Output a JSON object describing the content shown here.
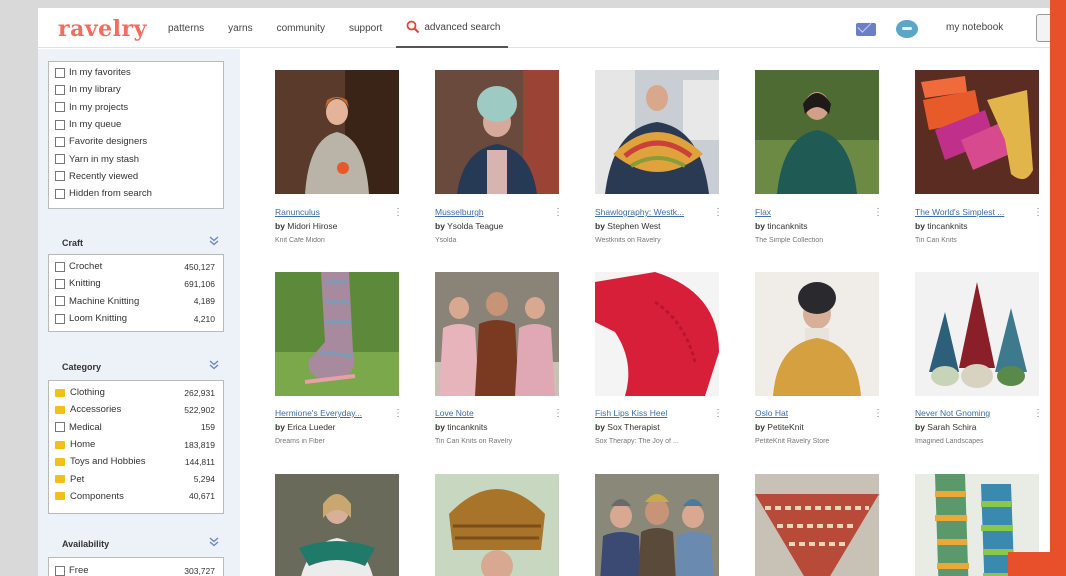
{
  "header": {
    "logo": "ravelry",
    "nav": [
      "patterns",
      "yarns",
      "community",
      "support"
    ],
    "advanced_search": "advanced search",
    "notebook": "my notebook"
  },
  "sidebar": {
    "personal_filters": [
      "In my favorites",
      "In my library",
      "In my projects",
      "In my queue",
      "Favorite designers",
      "Yarn in my stash",
      "Recently viewed",
      "Hidden from search"
    ],
    "craft": {
      "title": "Craft",
      "items": [
        {
          "label": "Crochet",
          "count": "450,127"
        },
        {
          "label": "Knitting",
          "count": "691,106"
        },
        {
          "label": "Machine Knitting",
          "count": "4,189"
        },
        {
          "label": "Loom Knitting",
          "count": "4,210"
        }
      ]
    },
    "category": {
      "title": "Category",
      "items": [
        {
          "label": "Clothing",
          "count": "262,931",
          "icon": "folder"
        },
        {
          "label": "Accessories",
          "count": "522,902",
          "icon": "folder"
        },
        {
          "label": "Medical",
          "count": "159",
          "icon": "checkbox"
        },
        {
          "label": "Home",
          "count": "183,819",
          "icon": "folder"
        },
        {
          "label": "Toys and Hobbies",
          "count": "144,811",
          "icon": "folder"
        },
        {
          "label": "Pet",
          "count": "5,294",
          "icon": "folder"
        },
        {
          "label": "Components",
          "count": "40,671",
          "icon": "folder"
        }
      ]
    },
    "availability": {
      "title": "Availability",
      "items": [
        {
          "label": "Free",
          "count": "303,727"
        }
      ]
    }
  },
  "patterns": [
    {
      "title": "Ranunculus",
      "by": "by",
      "designer": "Midori Hirose",
      "source": "Knit Cafe Midori"
    },
    {
      "title": "Musselburgh",
      "by": "by",
      "designer": "Ysolda Teague",
      "source": "Ysolda"
    },
    {
      "title": "Shawlography: Westk...",
      "by": "by",
      "designer": "Stephen West",
      "source": "Westknits on Ravelry"
    },
    {
      "title": "Flax",
      "by": "by",
      "designer": "tincanknits",
      "source": "The Simple Collection"
    },
    {
      "title": "The World's Simplest ...",
      "by": "by",
      "designer": "tincanknits",
      "source": "Tin Can Knits"
    },
    {
      "title": "Hermione's Everyday...",
      "by": "by",
      "designer": "Erica Lueder",
      "source": "Dreams in Fiber"
    },
    {
      "title": "Love Note",
      "by": "by",
      "designer": "tincanknits",
      "source": "Tin Can Knits on Ravelry"
    },
    {
      "title": "Fish Lips Kiss Heel",
      "by": "by",
      "designer": "Sox Therapist",
      "source": "Sox Therapy: The Joy of ..."
    },
    {
      "title": "Oslo Hat",
      "by": "by",
      "designer": "PetiteKnit",
      "source": "PetiteKnit Ravelry Store"
    },
    {
      "title": "Never Not Gnoming",
      "by": "by",
      "designer": "Sarah Schira",
      "source": "Imagined Landscapes"
    },
    {
      "title": "",
      "by": "",
      "designer": "",
      "source": ""
    },
    {
      "title": "",
      "by": "",
      "designer": "",
      "source": ""
    },
    {
      "title": "",
      "by": "",
      "designer": "",
      "source": ""
    },
    {
      "title": "",
      "by": "",
      "designer": "",
      "source": ""
    },
    {
      "title": "",
      "by": "",
      "designer": "",
      "source": ""
    }
  ],
  "colors": {
    "brand": "#ee6e62",
    "link": "#3c6ea7",
    "sidebar_bg": "#ecf2f7",
    "folder": "#f2c118",
    "accent_frame": "#e8502b"
  }
}
